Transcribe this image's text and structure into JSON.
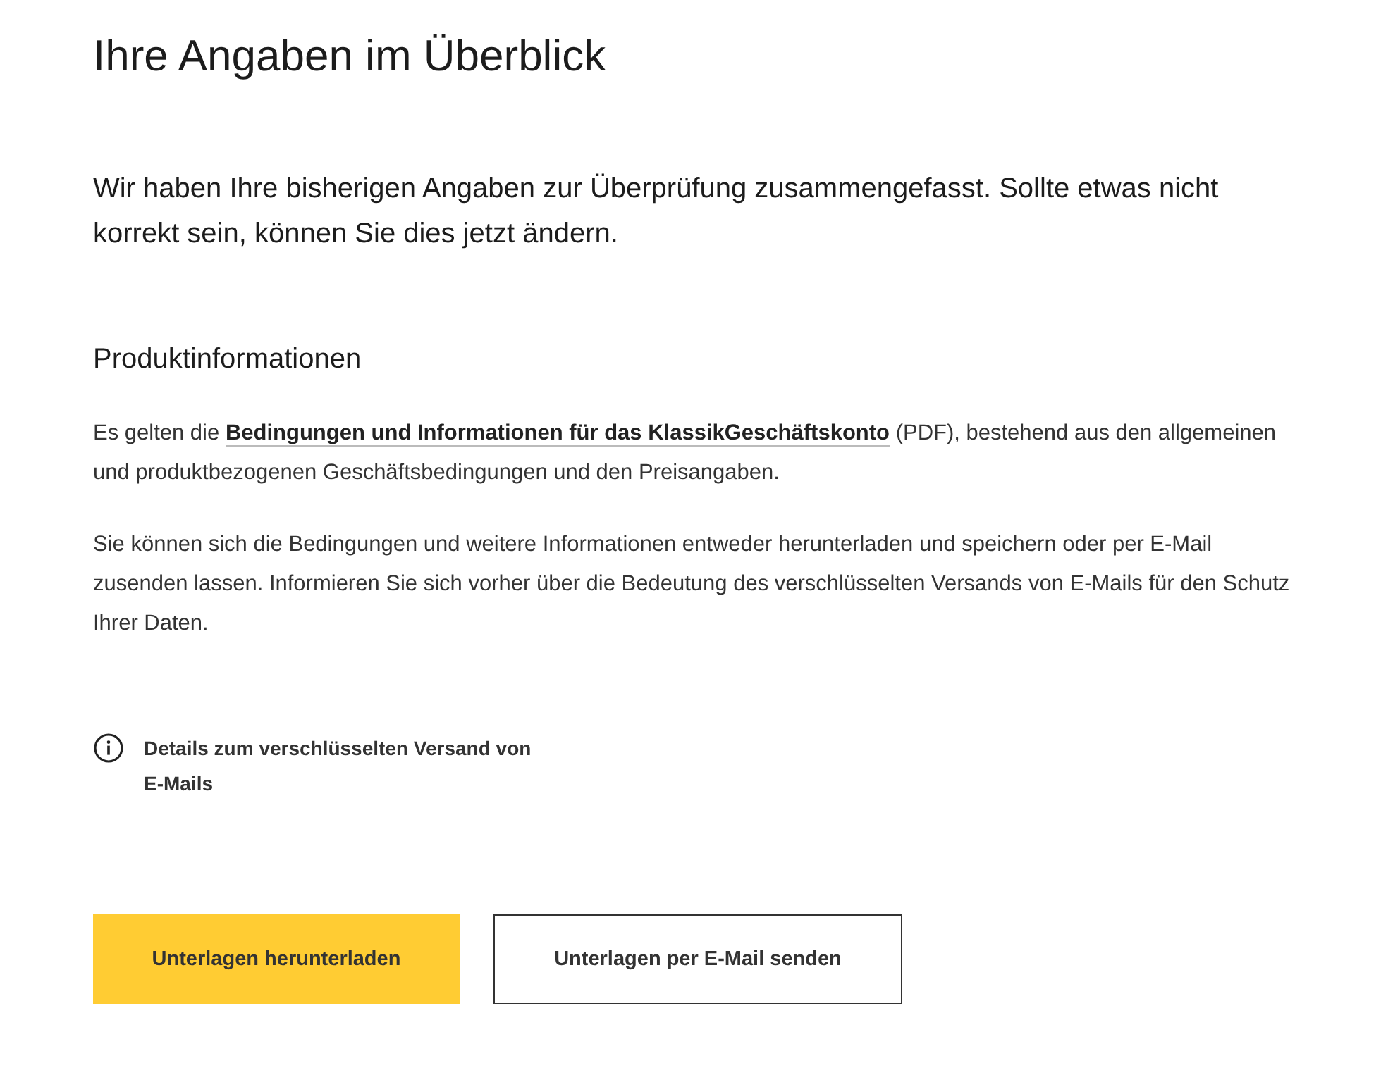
{
  "title": "Ihre Angaben im Überblick",
  "intro": "Wir haben Ihre bisherigen Angaben zur Überprüfung zusammengefasst. Sollte etwas nicht korrekt sein, können Sie dies jetzt ändern.",
  "section_title": "Produktinformationen",
  "terms_paragraph": {
    "before": "Es gelten die",
    "link": "Bedingungen und Informationen für das KlassikGeschäftskonto",
    "after": "(PDF), bestehend aus den allgemeinen und produktbezogenen Geschäftsbedingungen und den Preisangaben."
  },
  "info_paragraph": "Sie können sich die Bedingungen und weitere Informationen entweder herunterladen und speichern oder per E-Mail zusenden lassen. Informieren Sie sich vorher über die Bedeutung des verschlüsselten Versands von E-Mails für den Schutz Ihrer Daten.",
  "details_link": "Details zum verschlüsselten Versand von E-Mails",
  "buttons": [
    {
      "label": "Unterlagen herunterladen",
      "kind": "primary"
    },
    {
      "label": "Unterlagen per E-Mail senden",
      "kind": "secondary"
    }
  ]
}
